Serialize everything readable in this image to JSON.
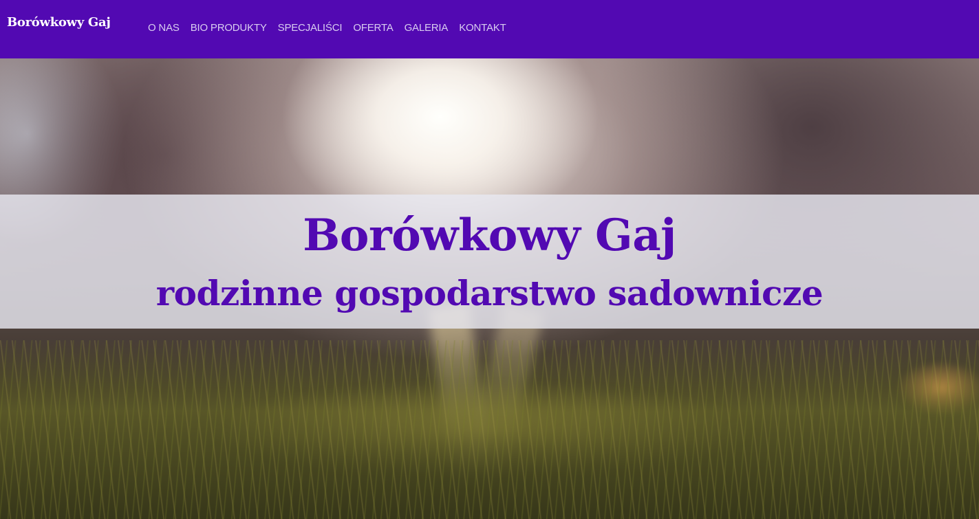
{
  "header": {
    "brand": "Borówkowy Gaj",
    "nav": [
      {
        "label": "O NAS"
      },
      {
        "label": "BIO PRODUKTY"
      },
      {
        "label": "SPECJALIŚCI"
      },
      {
        "label": "OFERTA"
      },
      {
        "label": "GALERIA"
      },
      {
        "label": "KONTAKT"
      }
    ]
  },
  "hero": {
    "title": "Borówkowy Gaj",
    "subtitle": "rodzinne gospodarstwo sadownicze",
    "background_image": "sunlit-grass-meadow-photo"
  },
  "colors": {
    "brand_purple": "#5209b2",
    "nav_text": "#d9cdf0",
    "banner_overlay": "#e8e8f0"
  }
}
